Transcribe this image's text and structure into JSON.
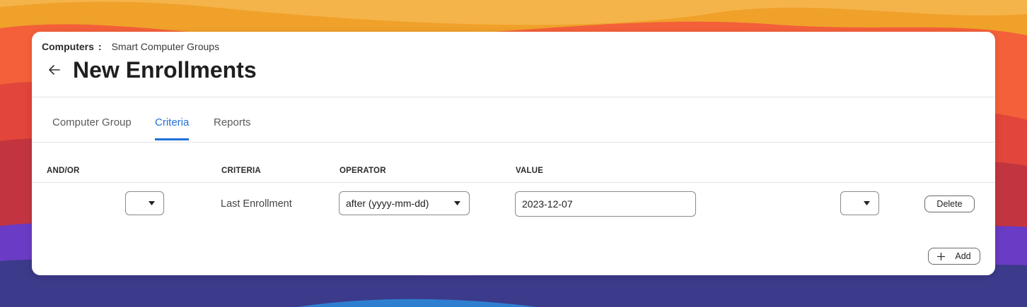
{
  "breadcrumb": {
    "root": "Computers",
    "separator": ":",
    "current": "Smart Computer Groups"
  },
  "page": {
    "title": "New Enrollments"
  },
  "tabs": [
    {
      "label": "Computer Group",
      "active": false
    },
    {
      "label": "Criteria",
      "active": true
    },
    {
      "label": "Reports",
      "active": false
    }
  ],
  "table": {
    "columns": [
      "AND/OR",
      "CRITERIA",
      "OPERATOR",
      "VALUE"
    ],
    "rows": [
      {
        "and_or": "",
        "criteria": "Last Enrollment",
        "operator": "after (yyyy-mm-dd)",
        "value": "2023-12-07",
        "parenthesis": "",
        "delete_label": "Delete"
      }
    ]
  },
  "actions": {
    "add_label": "Add"
  },
  "colors": {
    "accent": "#1f6fdb",
    "text": "#1f1f1f",
    "border": "#8a8a8a"
  },
  "icons": {
    "back": "arrow-left-icon",
    "dropdown": "caret-down-icon",
    "add": "plus-icon"
  }
}
